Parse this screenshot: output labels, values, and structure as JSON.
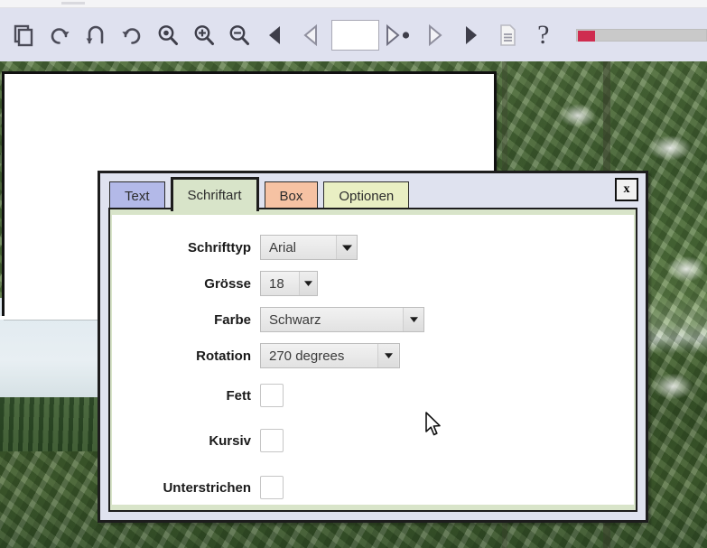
{
  "toolbar": {
    "buttons": [
      {
        "name": "copy-page-icon",
        "label": ""
      },
      {
        "name": "rotate-ccw-icon",
        "label": ""
      },
      {
        "name": "undo-icon",
        "label": ""
      },
      {
        "name": "rotate-cw-icon",
        "label": ""
      },
      {
        "name": "zoom-actual-icon",
        "label": ""
      },
      {
        "name": "zoom-in-icon",
        "label": ""
      },
      {
        "name": "zoom-out-icon",
        "label": ""
      },
      {
        "name": "first-page-icon",
        "label": ""
      },
      {
        "name": "previous-page-icon",
        "label": ""
      }
    ],
    "page_field_value": "",
    "page_field_placeholder": "",
    "buttons_right": [
      {
        "name": "next-page-icon",
        "label": ""
      },
      {
        "name": "last-page-icon",
        "label": ""
      },
      {
        "name": "goto-end-icon",
        "label": ""
      },
      {
        "name": "document-icon",
        "label": ""
      }
    ],
    "help_label": "?",
    "progress_percent": 12
  },
  "dialog": {
    "close_label": "x",
    "tabs": [
      {
        "label": "Text",
        "active": false,
        "color": "#b3b9e8"
      },
      {
        "label": "Schriftart",
        "active": true,
        "color": "#d8e4c9"
      },
      {
        "label": "Box",
        "active": false,
        "color": "#f6c2a3"
      },
      {
        "label": "Optionen",
        "active": false,
        "color": "#e9efc3"
      }
    ],
    "fields": [
      {
        "label": "Schrifttyp",
        "type": "combo",
        "value": "Arial",
        "width": "w-font"
      },
      {
        "label": "Grösse",
        "type": "combo",
        "value": "18",
        "width": "w-size"
      },
      {
        "label": "Farbe",
        "type": "combo",
        "value": "Schwarz",
        "width": "w-color"
      },
      {
        "label": "Rotation",
        "type": "combo",
        "value": "270 degrees",
        "width": "w-rot"
      },
      {
        "label": "Fett",
        "type": "checkbox",
        "value": "",
        "checked": false
      },
      {
        "label": "Kursiv",
        "type": "checkbox",
        "value": "",
        "checked": false
      },
      {
        "label": "Unterstrichen",
        "type": "checkbox",
        "value": "",
        "checked": false
      }
    ]
  },
  "colors": {
    "toolbar_bg": "#dfe2ef",
    "dialog_bg": "#dfe2ef",
    "panel_bg": "#d8e4c9",
    "content_bg": "#ffffff",
    "progress_accent": "#cf2c4f",
    "border": "#1d1d1d"
  }
}
